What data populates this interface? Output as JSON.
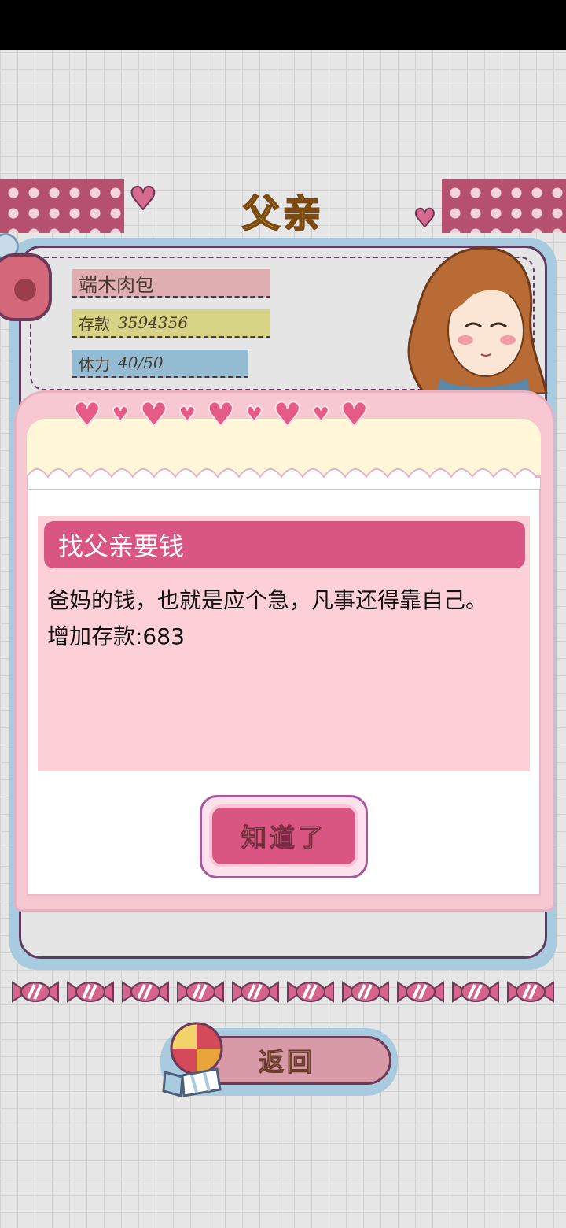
{
  "screen": {
    "title": "父亲"
  },
  "profile": {
    "name": "端木肉包",
    "money_label": "存款",
    "money_value": "3594356",
    "energy_label": "体力",
    "energy_value": "40/50"
  },
  "dialog": {
    "event_title": "找父亲要钱",
    "message_line1": "爸妈的钱，也就是应个急，凡事还得靠自己。",
    "message_line2": "增加存款:683",
    "ok_label": "知道了"
  },
  "footer": {
    "back_label": "返回"
  },
  "colors": {
    "accent_pink": "#d95683",
    "title_yellow": "#ecc33a",
    "frame_blue": "#a9cbe0",
    "banner_plum": "#b5506e"
  }
}
